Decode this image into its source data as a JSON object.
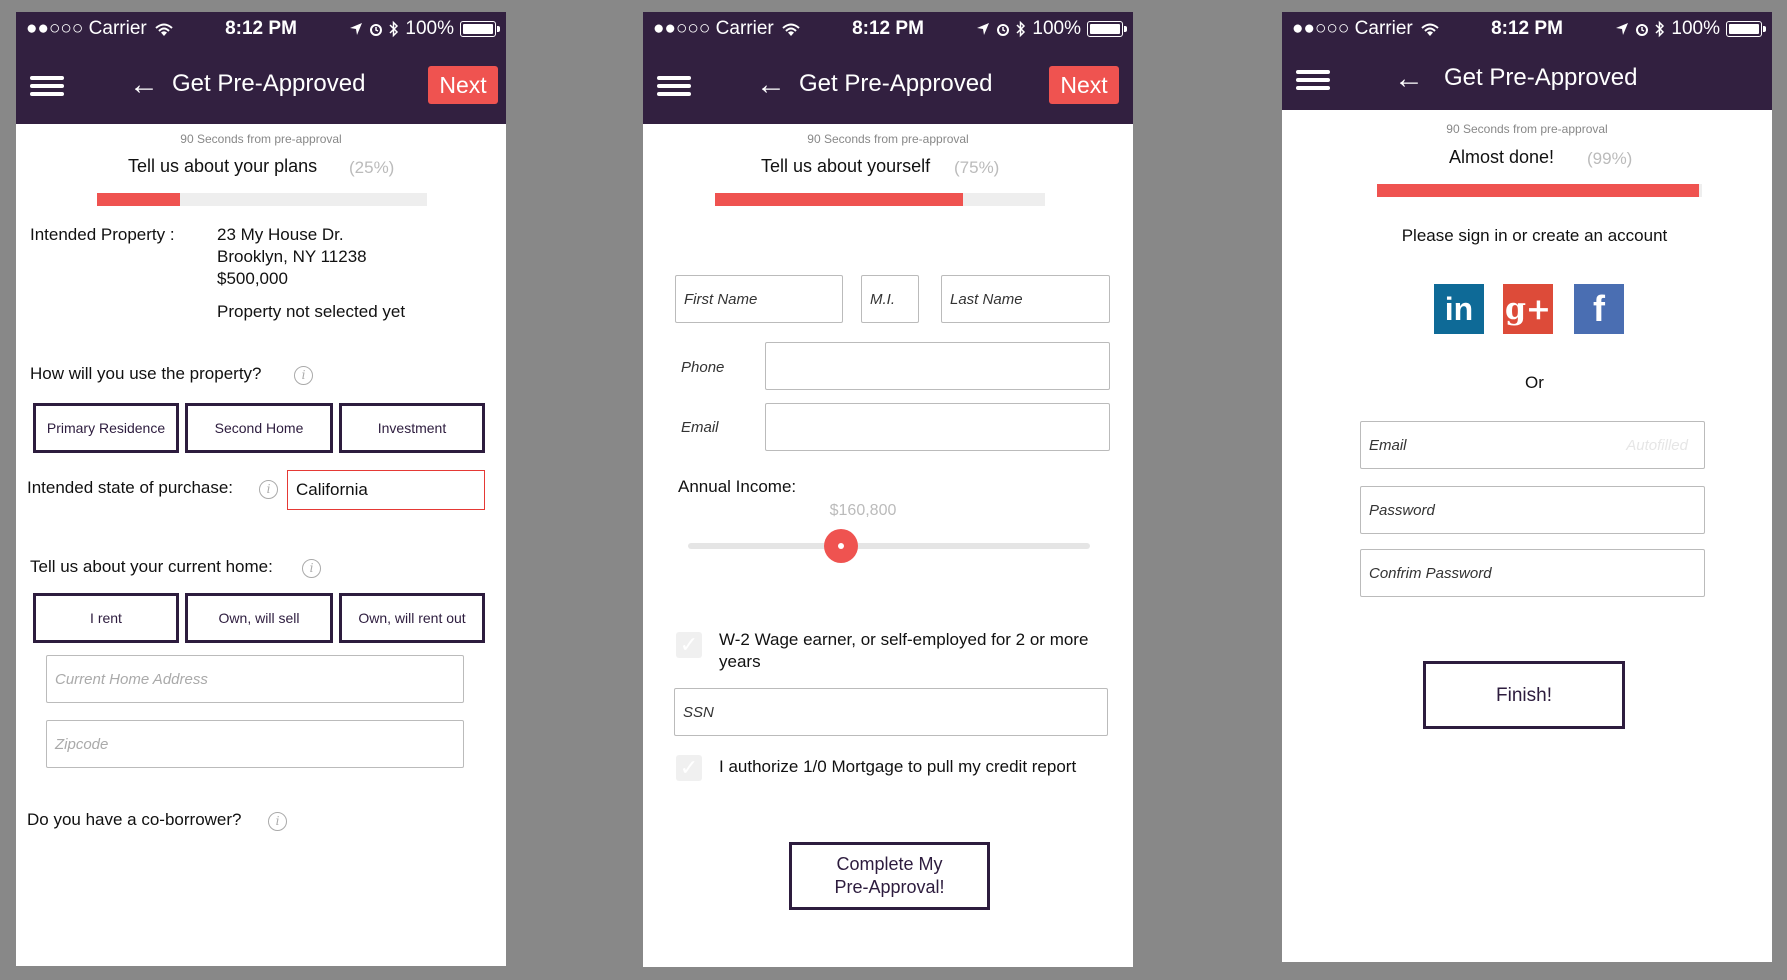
{
  "status": {
    "carrier": "●●○○○ Carrier",
    "time": "8:12 PM",
    "battery": "100%"
  },
  "nav": {
    "title": "Get Pre-Approved",
    "next_label": "Next"
  },
  "subtitle": "90 Seconds from pre-approval",
  "colors": {
    "navbar": "#322040",
    "accent": "#ef5350",
    "button_border": "#2d1c3e"
  },
  "icons": [
    "wifi-icon",
    "location-icon",
    "alarm-icon",
    "bluetooth-icon",
    "battery-icon",
    "menu-icon",
    "back-arrow-icon",
    "info-icon",
    "checkmark-icon"
  ],
  "screen1": {
    "step": "Tell us about your plans",
    "percent_label": "(25%)",
    "progress": 0.25,
    "property_label": "Intended Property :",
    "address_line1": "23 My House Dr.",
    "address_line2": "Brooklyn, NY 11238",
    "price": "$500,000",
    "not_selected": "Property not selected yet",
    "use_question": "How will you use the property?",
    "use_options": [
      "Primary Residence",
      "Second Home",
      "Investment"
    ],
    "state_label": "Intended state of purchase:",
    "state_value": "California",
    "current_home_label": "Tell us about your current home:",
    "home_options": [
      "I rent",
      "Own, will sell",
      "Own, will rent out"
    ],
    "address_placeholder": "Current Home Address",
    "zip_placeholder": "Zipcode",
    "coborrower_question": "Do you have a co-borrower?"
  },
  "screen2": {
    "step": "Tell us about yourself",
    "percent_label": "(75%)",
    "progress": 0.75,
    "first_name": "First Name",
    "mi": "M.I.",
    "last_name": "Last Name",
    "phone_label": "Phone",
    "email_label": "Email",
    "income_label": "Annual Income:",
    "income_value": "$160,800",
    "income_slider_position": 0.38,
    "w2_text": "W-2 Wage earner, or self-employed for 2 or more years",
    "ssn": "SSN",
    "authorize_text": "I authorize 1/0 Mortgage to pull my credit report",
    "complete_line1": "Complete My",
    "complete_line2": "Pre-Approval!"
  },
  "screen3": {
    "step": "Almost done!",
    "percent_label": "(99%)",
    "progress": 0.99,
    "sign_in_text": "Please sign in or create an account",
    "social": [
      {
        "name": "linkedin",
        "label": "in",
        "color": "#0e6a97"
      },
      {
        "name": "google-plus",
        "label": "g+",
        "color": "#dd4b39"
      },
      {
        "name": "facebook",
        "label": "f",
        "color": "#4a6eb2"
      }
    ],
    "or_text": "Or",
    "email_label": "Email",
    "email_hint": "Autofilled",
    "password_label": "Password",
    "confirm_label": "Confrim Password",
    "finish_label": "Finish!"
  }
}
